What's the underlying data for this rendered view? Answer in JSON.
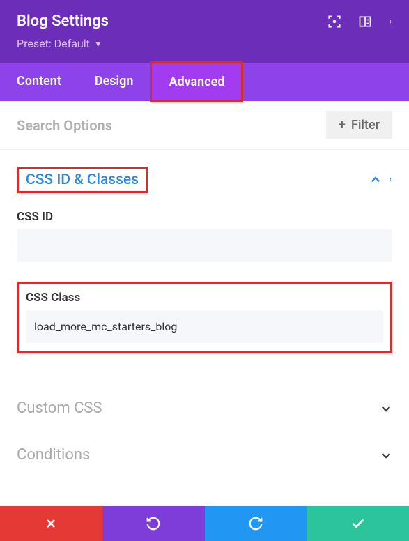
{
  "header": {
    "title": "Blog Settings",
    "preset_label": "Preset: Default"
  },
  "tabs": {
    "content": "Content",
    "design": "Design",
    "advanced": "Advanced"
  },
  "search": {
    "placeholder": "Search Options",
    "filter_label": "Filter"
  },
  "sections": {
    "css_classes": {
      "title": "CSS ID & Classes",
      "css_id_label": "CSS ID",
      "css_id_value": "",
      "css_class_label": "CSS Class",
      "css_class_value": "load_more_mc_starters_blog"
    },
    "custom_css": {
      "title": "Custom CSS"
    },
    "conditions": {
      "title": "Conditions"
    }
  }
}
